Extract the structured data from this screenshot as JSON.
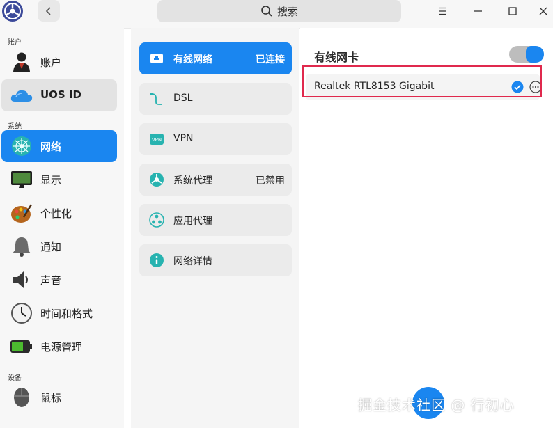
{
  "header": {
    "search_label": "搜索",
    "icons": [
      "app-logo",
      "back-arrow",
      "search-icon",
      "menu-icon",
      "minimize-icon",
      "maximize-icon",
      "close-icon"
    ]
  },
  "sidebar": {
    "groups": [
      "账户",
      "系统",
      "设备"
    ],
    "items": [
      {
        "label": "账户",
        "icon": "account-icon",
        "state": "normal"
      },
      {
        "label": "UOS ID",
        "icon": "cloud-icon",
        "state": "hover"
      },
      {
        "label": "网络",
        "icon": "network-icon",
        "state": "selected"
      },
      {
        "label": "显示",
        "icon": "display-icon",
        "state": "normal"
      },
      {
        "label": "个性化",
        "icon": "personalization-icon",
        "state": "normal"
      },
      {
        "label": "通知",
        "icon": "notification-icon",
        "state": "normal"
      },
      {
        "label": "声音",
        "icon": "sound-icon",
        "state": "normal"
      },
      {
        "label": "时间和格式",
        "icon": "clock-icon",
        "state": "normal"
      },
      {
        "label": "电源管理",
        "icon": "battery-icon",
        "state": "normal"
      },
      {
        "label": "鼠标",
        "icon": "mouse-icon",
        "state": "normal"
      }
    ]
  },
  "network_menu": {
    "items": [
      {
        "label": "有线网络",
        "status": "已连接",
        "icon": "wired-icon",
        "state": "selected"
      },
      {
        "label": "DSL",
        "status": "",
        "icon": "dsl-icon",
        "state": "normal"
      },
      {
        "label": "VPN",
        "status": "",
        "icon": "vpn-icon",
        "state": "normal"
      },
      {
        "label": "系统代理",
        "status": "已禁用",
        "icon": "proxy-icon",
        "state": "normal"
      },
      {
        "label": "应用代理",
        "status": "",
        "icon": "app-proxy-icon",
        "state": "normal"
      },
      {
        "label": "网络详情",
        "status": "",
        "icon": "info-icon",
        "state": "normal"
      }
    ]
  },
  "wired_panel": {
    "title": "有线网卡",
    "enabled": true,
    "device": {
      "name": "Realtek RTL8153 Gigabit",
      "connected": true
    }
  },
  "watermark": "掘金技术社区 @ 行初心",
  "colors": {
    "accent": "#1a86f0",
    "highlight": "#e0294d"
  }
}
